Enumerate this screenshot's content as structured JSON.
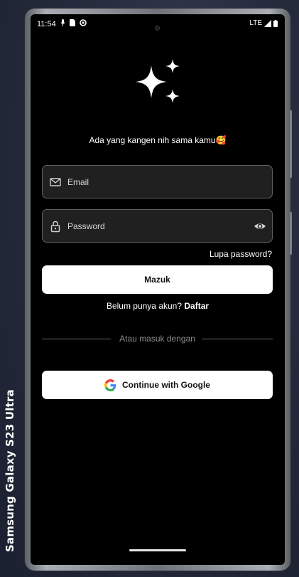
{
  "device": {
    "label": "Samsung Galaxy  S23 Ultra"
  },
  "status_bar": {
    "time": "11:54",
    "network": "LTE"
  },
  "login": {
    "greeting": "Ada yang kangen nih sama kamu🥰",
    "email_placeholder": "Email",
    "password_placeholder": "Password",
    "forgot_password": "Lupa password?",
    "login_button": "Mazuk",
    "no_account_text": "Belum punya akun?",
    "register_link": "Daftar",
    "divider_text": "Atau masuk dengan",
    "google_button": "Continue with Google"
  },
  "icons": {
    "logo": "sparkles-icon",
    "email": "mail-icon",
    "password": "lock-icon",
    "toggle_visibility": "eye-icon",
    "google": "google-icon"
  },
  "colors": {
    "background": "#000000",
    "field_background": "#202020",
    "field_border": "#5f5f5f",
    "button_background": "#ffffff",
    "button_text": "#111111"
  }
}
